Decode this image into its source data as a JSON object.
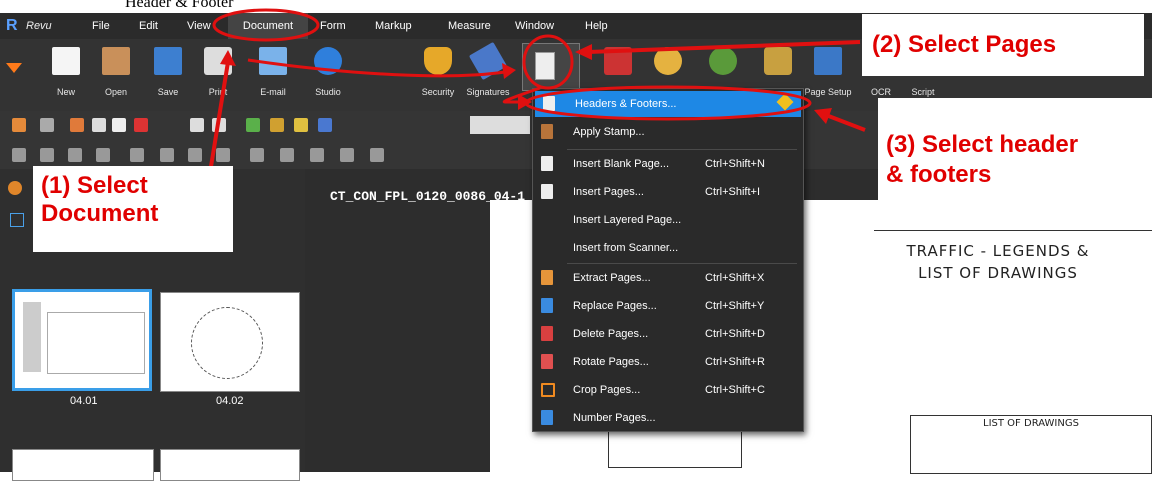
{
  "caption": "Header & Footer",
  "app": {
    "logo_text": "Revu"
  },
  "menu": [
    "File",
    "Edit",
    "View",
    "Document",
    "Form",
    "Markup",
    "Measure",
    "Window",
    "Help"
  ],
  "ribbon": {
    "left": [
      "New",
      "Open",
      "Save",
      "Print",
      "E-mail",
      "Studio"
    ],
    "right": [
      "Security",
      "Signatures"
    ],
    "far": [
      "Page Setup",
      "OCR",
      "Script"
    ]
  },
  "tab_title": "CT_CON_FPL_0120_0086_04-1",
  "thumbnails": [
    "04.01",
    "04.02"
  ],
  "dropdown": [
    {
      "label": "Headers & Footers...",
      "shortcut": "",
      "highlight": true
    },
    {
      "label": "Apply Stamp...",
      "shortcut": ""
    },
    {
      "label": "Insert Blank Page...",
      "shortcut": "Ctrl+Shift+N"
    },
    {
      "label": "Insert Pages...",
      "shortcut": "Ctrl+Shift+I"
    },
    {
      "label": "Insert Layered Page...",
      "shortcut": ""
    },
    {
      "label": "Insert from Scanner...",
      "shortcut": ""
    },
    {
      "label": "Extract Pages...",
      "shortcut": "Ctrl+Shift+X"
    },
    {
      "label": "Replace Pages...",
      "shortcut": "Ctrl+Shift+Y"
    },
    {
      "label": "Delete Pages...",
      "shortcut": "Ctrl+Shift+D"
    },
    {
      "label": "Rotate Pages...",
      "shortcut": "Ctrl+Shift+R"
    },
    {
      "label": "Crop Pages...",
      "shortcut": "Ctrl+Shift+C"
    },
    {
      "label": "Number Pages...",
      "shortcut": ""
    }
  ],
  "callouts": {
    "step1": "(1) Select Document",
    "step1_line1": "(1) Select",
    "step1_line2": "Document",
    "step2": "(2) Select Pages",
    "step3_line1": "(3) Select header",
    "step3_line2": "& footers"
  },
  "document": {
    "title_line1": "TRAFFIC - LEGENDS &",
    "title_line2": "LIST OF DRAWINGS",
    "table_title": "LIST OF DRAWINGS"
  },
  "colors": {
    "highlight": "#1e88e5",
    "callout_text": "#e00000",
    "annotation": "#e01010"
  }
}
